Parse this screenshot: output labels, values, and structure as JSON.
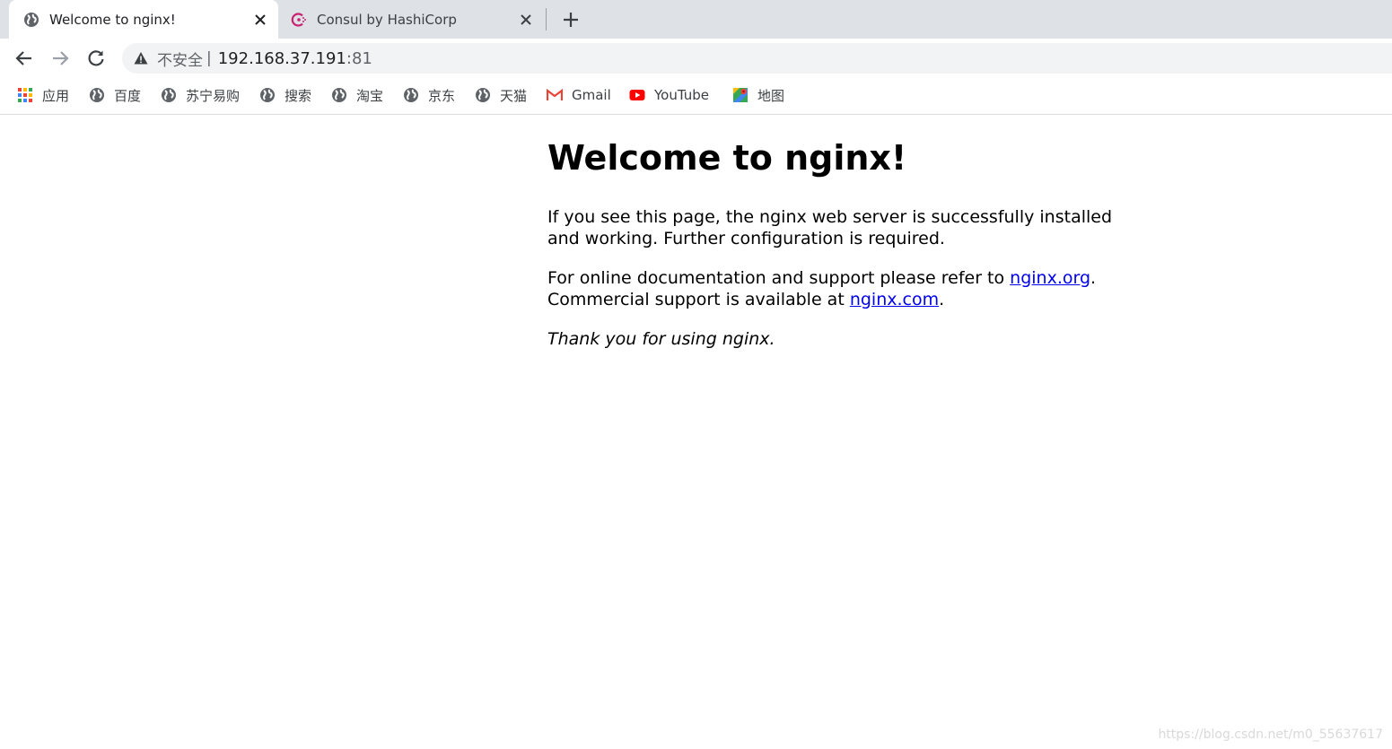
{
  "tabs": [
    {
      "title": "Welcome to nginx!",
      "icon": "globe-icon",
      "active": true
    },
    {
      "title": "Consul by HashiCorp",
      "icon": "consul-icon",
      "active": false
    }
  ],
  "toolbar": {
    "security_label": "不安全",
    "separator": "|",
    "url_host": "192.168.37.191",
    "url_port": ":81"
  },
  "bookmarks": [
    {
      "label": "应用",
      "icon": "apps-grid-icon"
    },
    {
      "label": "百度",
      "icon": "globe-icon"
    },
    {
      "label": "苏宁易购",
      "icon": "globe-icon"
    },
    {
      "label": "搜索",
      "icon": "globe-icon"
    },
    {
      "label": "淘宝",
      "icon": "globe-icon"
    },
    {
      "label": "京东",
      "icon": "globe-icon"
    },
    {
      "label": "天猫",
      "icon": "globe-icon"
    },
    {
      "label": "Gmail",
      "icon": "gmail-icon"
    },
    {
      "label": "YouTube",
      "icon": "youtube-icon"
    },
    {
      "label": "地图",
      "icon": "maps-icon"
    }
  ],
  "page": {
    "heading": "Welcome to nginx!",
    "para1": "If you see this page, the nginx web server is successfully installed and working. Further configuration is required.",
    "para2_prefix": "For online documentation and support please refer to ",
    "link_org": "nginx.org",
    "para2_mid": ".",
    "para2_line2": "Commercial support is available at ",
    "link_com": "nginx.com",
    "para2_end": ".",
    "thanks": "Thank you for using nginx."
  },
  "watermark": "https://blog.csdn.net/m0_55637617",
  "colors": {
    "tabstrip_bg": "#dee1e6",
    "link": "#0000ee",
    "consul_brand": "#ca2171",
    "youtube_red": "#ff0000",
    "gmail_red": "#ea4335"
  }
}
